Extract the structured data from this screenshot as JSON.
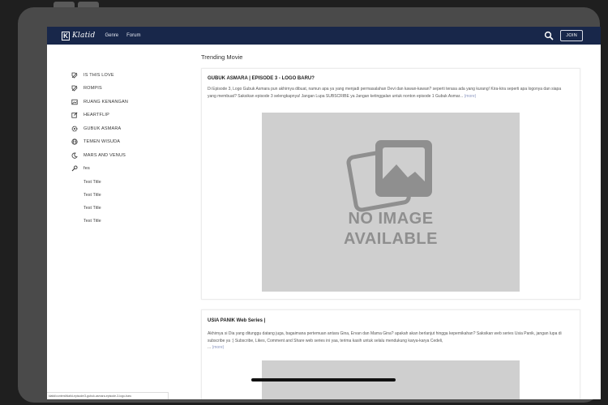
{
  "navbar": {
    "logo_letter": "K",
    "logo_text": "Klatid",
    "links": [
      "Genre",
      "Forum"
    ],
    "join_label": "JOIN"
  },
  "sidebar": {
    "items": [
      {
        "label": "IS THIS LOVE",
        "icon": "tag-icon"
      },
      {
        "label": "ROMPIS",
        "icon": "tag-icon"
      },
      {
        "label": "RUANG KENANGAN",
        "icon": "image-icon"
      },
      {
        "label": "HEARTFLIP",
        "icon": "edit-icon"
      },
      {
        "label": "GUBUK ASMARA",
        "icon": "gear-icon"
      },
      {
        "label": "TEMEN WISUDA",
        "icon": "globe-icon"
      },
      {
        "label": "MARS AND VENUS",
        "icon": "moon-icon"
      },
      {
        "label": "fes",
        "icon": "wrench-icon"
      }
    ],
    "sub_items": [
      "Test Title",
      "Test Title",
      "Test Title",
      "Test Title"
    ]
  },
  "main": {
    "title": "Trending Movie",
    "posts": [
      {
        "title": "GUBUK ASMARA | EPISODE 3 - LOGO BARU?",
        "text": "Di Episode 3, Logo Gubuk Asmara pun akhirnya dibuat, namun apa ya yang menjadi permasalahan Devi dan kawan-kawan? seperti terasa ada yang kurang! Kira-kira seperti apa logonya dan siapa yang membuat? Saksikan episode 3 selengkapnya! Jangan Lupa SUBSCRIBE ya Jangan ketinggalan untuk nonton episode 1 Gubuk Asmar...",
        "more": "(more)",
        "image_text": [
          "NO IMAGE",
          "AVAILABLE"
        ]
      },
      {
        "title": "USIA PANIK Web Series |",
        "text": "Akhirnya si Dia yang ditunggu datang juga, bagaimana pertemuan antara Gina, Ervan dan Mama Gina? apakah akan berlanjut hingga kepemikahan? Saksikan web series Usia Panik, jangan lupa di subscribe ya :) Subscribe, Likes, Comment and Share web series ini yaa, terima kasih untuk selalu mendukung karya-karya Cedeli,",
        "more_prefix": "...",
        "more": "(more)"
      }
    ]
  },
  "status_url": "klatid/content/klatid-episode/3-gubuk-asmara-episode-3-logo-baru",
  "colors": {
    "navbar": "#18274a",
    "link_more": "#8a96c0",
    "placeholder": "#cfcfcf"
  }
}
